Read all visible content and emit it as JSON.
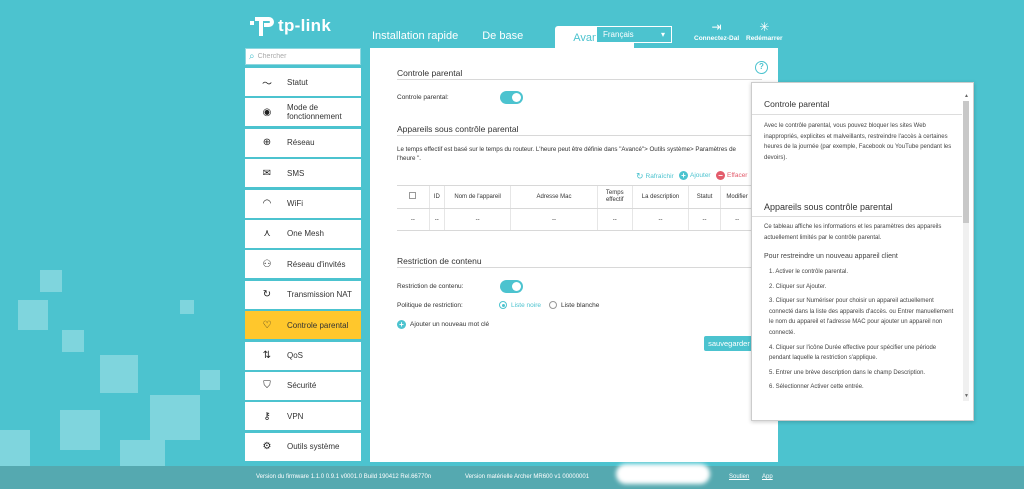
{
  "brand": {
    "name": "tp-link"
  },
  "nav": {
    "tabs": [
      {
        "label": "Installation rapide"
      },
      {
        "label": "De base"
      },
      {
        "label": "Avancée"
      }
    ],
    "language": "Français",
    "logout_label": "Connectez-Dal",
    "reboot_label": "Redémarrer"
  },
  "sidebar": {
    "search_placeholder": "Chercher",
    "items": [
      {
        "label": "Statut",
        "icon": "pulse-icon"
      },
      {
        "label": "Mode de fonctionnement",
        "icon": "toggle-icon"
      },
      {
        "label": "Réseau",
        "icon": "globe-icon"
      },
      {
        "label": "SMS",
        "icon": "envelope-icon"
      },
      {
        "label": "WiFi",
        "icon": "wifi-icon"
      },
      {
        "label": "One Mesh",
        "icon": "mesh-icon"
      },
      {
        "label": "Réseau d'invités",
        "icon": "guests-icon"
      },
      {
        "label": "Transmission NAT",
        "icon": "nat-icon"
      },
      {
        "label": "Controle parental",
        "icon": "heart-icon",
        "active": true
      },
      {
        "label": "QoS",
        "icon": "arrows-icon"
      },
      {
        "label": "Sécurité",
        "icon": "shield-icon"
      },
      {
        "label": "VPN",
        "icon": "key-icon"
      },
      {
        "label": "Outils système",
        "icon": "gear-icon"
      }
    ]
  },
  "main": {
    "parental": {
      "title": "Controle parental",
      "toggle_label": "Controle parental:",
      "enabled": true
    },
    "devices": {
      "title": "Appareils sous contrôle parental",
      "description": "Le temps effectif est basé sur le temps du routeur. L'heure peut être définie dans \"Avancé\"> Outils système> Paramètres de l'heure \".",
      "refresh_label": "Rafraîchir",
      "add_label": "Ajouter",
      "delete_label": "Effacer",
      "columns": [
        "ID",
        "Nom de l'appareil",
        "Adresse Mac",
        "Temps effectif",
        "La description",
        "Statut",
        "Modifier"
      ],
      "rows": [
        [
          "--",
          "--",
          "--",
          "--",
          "--",
          "--",
          "--",
          "--"
        ]
      ]
    },
    "content": {
      "title": "Restriction de contenu",
      "toggle_label": "Restriction de contenu:",
      "enabled": true,
      "policy_label": "Politique de restriction:",
      "option_blacklist": "Liste noire",
      "option_whitelist": "Liste blanche",
      "selected": "Liste noire",
      "add_keyword_label": "Ajouter un nouveau mot clé"
    },
    "save_label": "sauvegarder"
  },
  "help": {
    "title1": "Controle parental",
    "text1": "Avec le contrôle parental, vous pouvez bloquer les sites Web inappropriés, explicites et malveillants, restreindre l'accès à certaines heures de la journée (par exemple, Facebook ou YouTube pendant les devoirs).",
    "title2": "Appareils sous contrôle parental",
    "text2": "Ce tableau affiche les informations et les paramètres des appareils actuellement limités par le contrôle parental.",
    "subtitle": "Pour restreindre un nouveau appareil client",
    "steps": [
      "1. Activer le contrôle parental.",
      "2. Cliquer sur Ajouter.",
      "3. Cliquer sur Numériser pour choisir un appareil actuellement connecté dans la liste des appareils d'accès. ou Entrer manuellement le nom du appareil et l'adresse MAC pour ajouter un appareil non connecté.",
      "4. Cliquer sur l'icône Durée effective pour spécifier une période pendant laquelle la restriction s'applique.",
      "5. Entrer une brève description dans le champ Description.",
      "6. Sélectionner Activer cette entrée."
    ]
  },
  "footer": {
    "firmware": "Version du firmware 1.1.0 0.9.1 v0001.0 Build 190412 Rel.66770n",
    "hardware": "Version matérielle Archer MR600 v1 00000001",
    "support": "Soutien",
    "app": "App"
  }
}
